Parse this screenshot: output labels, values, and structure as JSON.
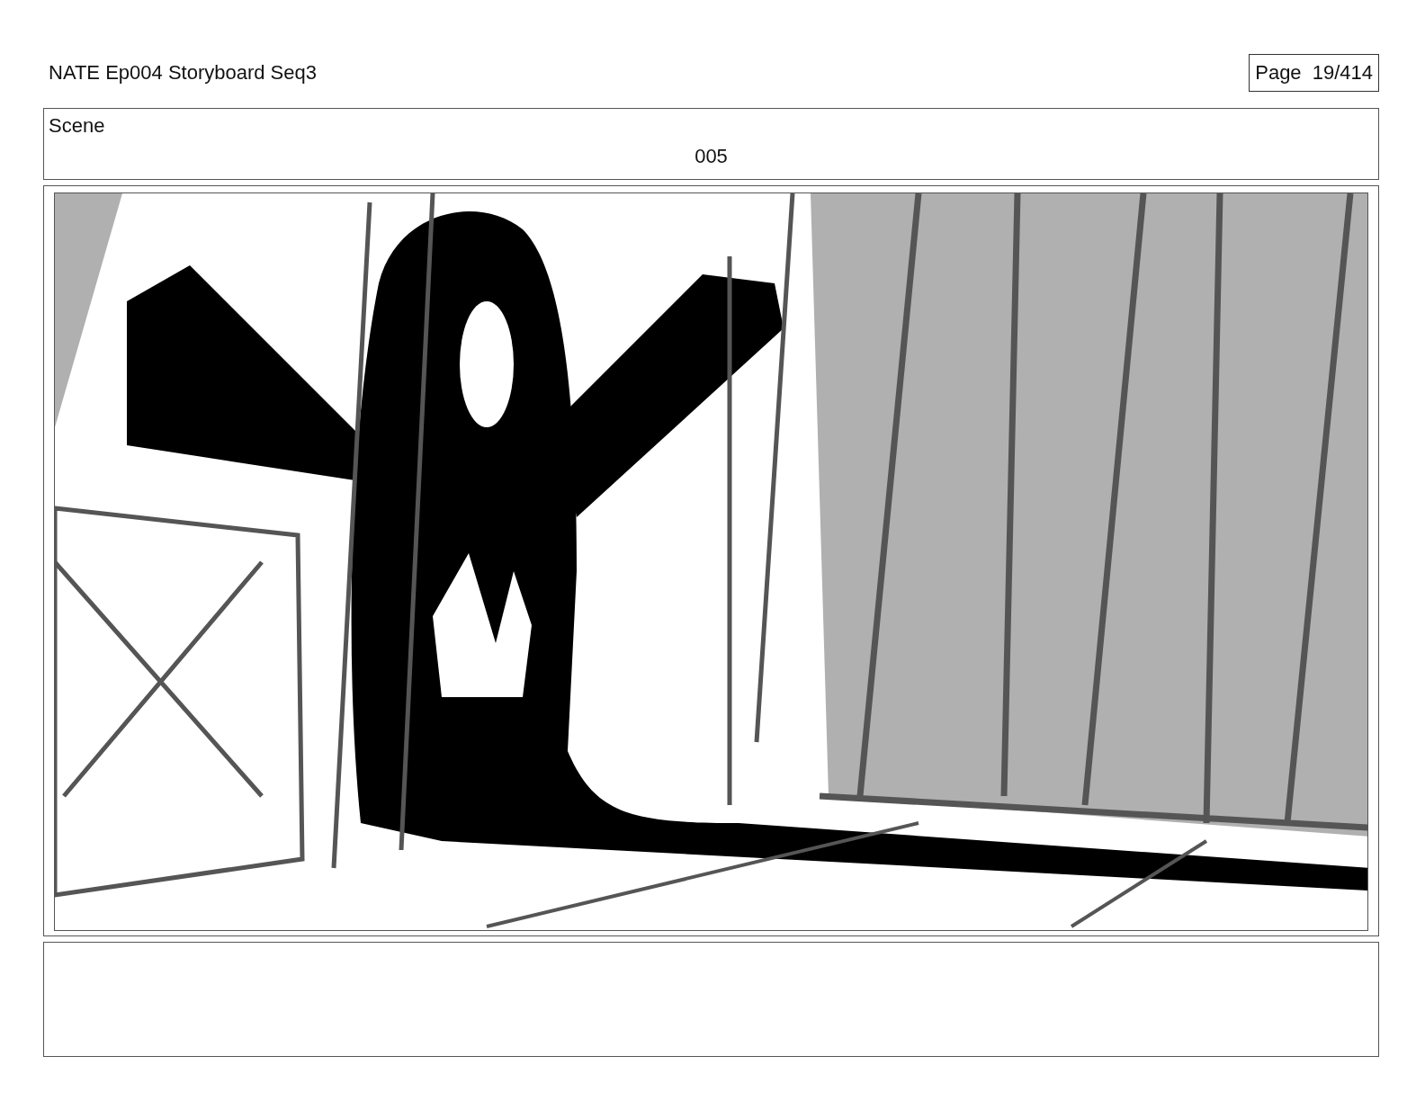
{
  "header": {
    "title": "NATE Ep004 Storyboard Seq3",
    "page": "Page 19/414"
  },
  "scene": {
    "label": "Scene",
    "number": "005"
  }
}
